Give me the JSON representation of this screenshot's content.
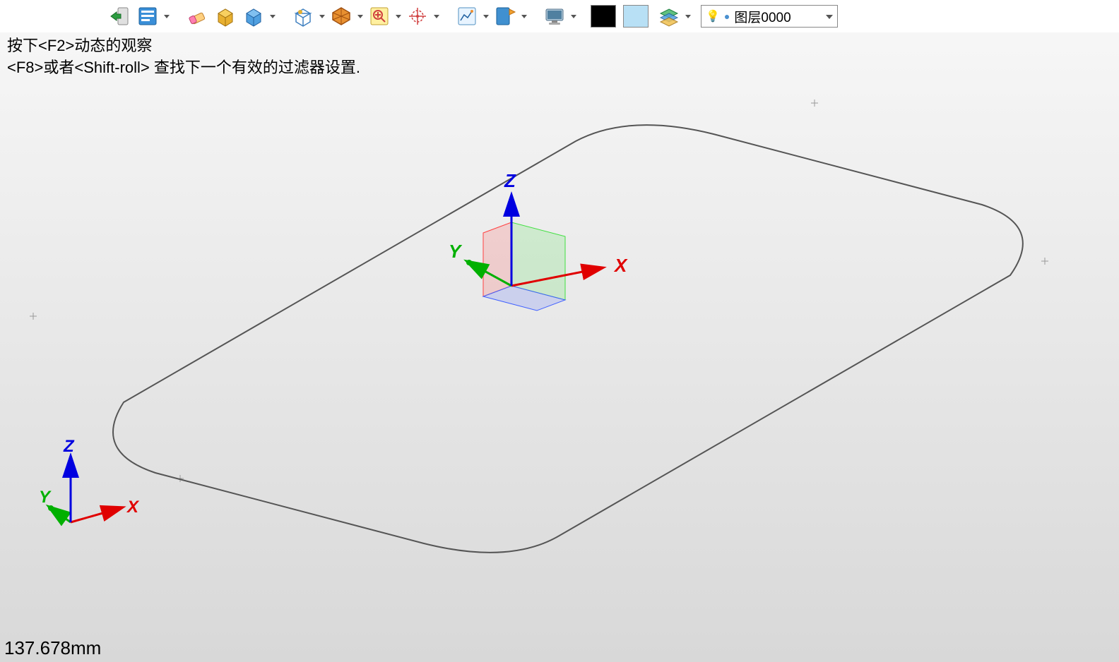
{
  "toolbar": {
    "layer_selected": "图层0000",
    "color_black": "#000000",
    "color_lightblue": "#b8e0f5"
  },
  "hints": {
    "line1": "按下<F2>动态的观察",
    "line2": " <F8>或者<Shift-roll> 查找下一个有效的过滤器设置."
  },
  "axes": {
    "x": "X",
    "y": "Y",
    "z": "Z"
  },
  "status": {
    "measurement": "137.678mm"
  }
}
